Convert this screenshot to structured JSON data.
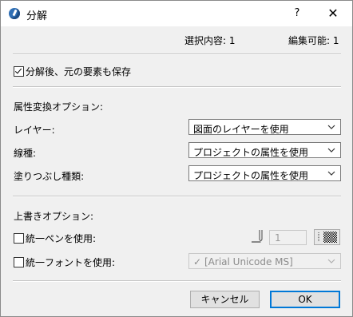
{
  "window": {
    "title": "分解",
    "help_label": "?",
    "close_label": "✕"
  },
  "summary": {
    "selected": "選択内容: 1",
    "editable": "編集可能: 1"
  },
  "keep_original": {
    "label": "分解後、元の要素も保存",
    "checked": true
  },
  "attribute_options": {
    "heading": "属性変換オプション:",
    "rows": [
      {
        "label": "レイヤー:",
        "value": "図面のレイヤーを使用"
      },
      {
        "label": "線種:",
        "value": "プロジェクトの属性を使用"
      },
      {
        "label": "塗りつぶし種類:",
        "value": "プロジェクトの属性を使用"
      }
    ]
  },
  "override_options": {
    "heading": "上書きオプション:",
    "pen": {
      "label": "統一ペンを使用:",
      "checked": false,
      "pen_value": "1"
    },
    "font": {
      "label": "統一フォントを使用:",
      "checked": false,
      "font_value": "[Arial Unicode MS]",
      "font_prefix_icon": "✓"
    }
  },
  "buttons": {
    "cancel": "キャンセル",
    "ok": "OK"
  },
  "icons": {
    "pen": "pen-icon",
    "pattern": "line-pattern-icon",
    "chevron": "chevron-down-icon"
  },
  "colors": {
    "accent": "#0078d7"
  }
}
